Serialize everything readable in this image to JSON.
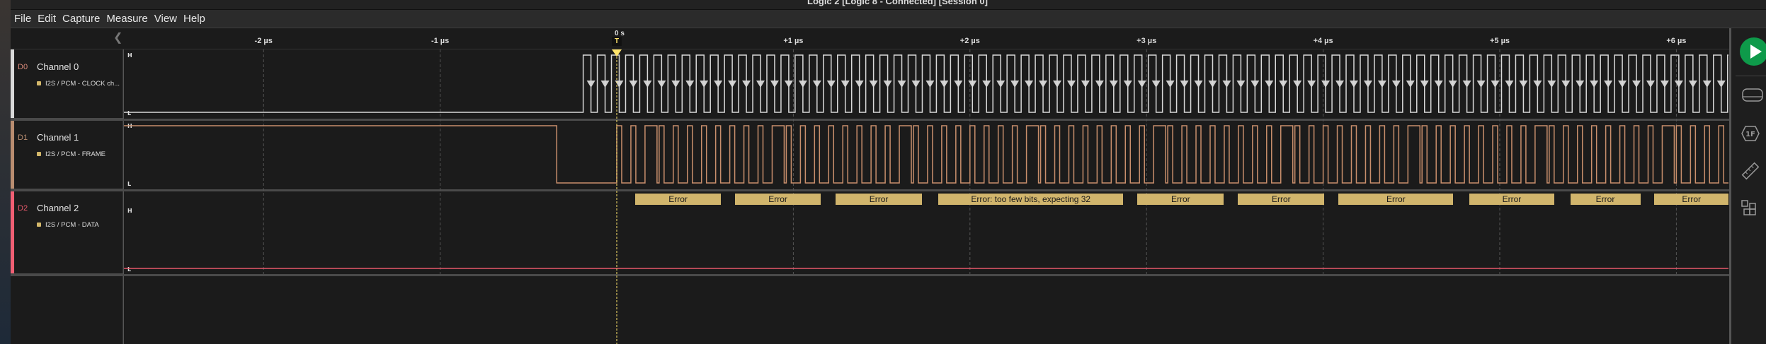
{
  "window": {
    "title": "Logic 2 [Logic 8 - Connected] [Session 0]"
  },
  "menu": [
    "File",
    "Edit",
    "Capture",
    "Measure",
    "View",
    "Help"
  ],
  "ruler": {
    "ticks": [
      {
        "t": -2,
        "label": "-2 µs"
      },
      {
        "t": -1,
        "label": "-1 µs"
      },
      {
        "t": 1,
        "label": "+1 µs"
      },
      {
        "t": 2,
        "label": "+2 µs"
      },
      {
        "t": 3,
        "label": "+3 µs"
      },
      {
        "t": 4,
        "label": "+4 µs"
      },
      {
        "t": 5,
        "label": "+5 µs"
      },
      {
        "t": 6,
        "label": "+6 µs"
      }
    ],
    "zero_label": "0 s",
    "trigger_label": "T",
    "collapse_icon": "chevron-left-icon"
  },
  "channels": [
    {
      "id": "D0",
      "name": "Channel 0",
      "analyzer": "I2S / PCM - CLOCK ch...",
      "color": "#d9d9d9",
      "high": "H",
      "low": "L"
    },
    {
      "id": "D1",
      "name": "Channel 1",
      "analyzer": "I2S / PCM - FRAME",
      "color": "#c98f6c",
      "high": "H",
      "low": "L"
    },
    {
      "id": "D2",
      "name": "Channel 2",
      "analyzer": "I2S / PCM - DATA",
      "color": "#e8596b",
      "high": "H",
      "low": "L"
    }
  ],
  "signals": {
    "time_unit": "µs",
    "view_range_us": [
      -2.9,
      6.3
    ],
    "trigger_us": 0,
    "clock": {
      "start_us": -0.19,
      "period_us": 0.08,
      "duty": 0.55
    },
    "frame": {
      "fall_us": -0.34,
      "rise_us": 0,
      "pulse_duty": 0.35
    },
    "data_level": "low"
  },
  "annotations": [
    {
      "label": "Error",
      "start": 0.104,
      "end": 0.59
    },
    {
      "label": "Error",
      "start": 0.67,
      "end": 1.155
    },
    {
      "label": "Error",
      "start": 1.239,
      "end": 1.729
    },
    {
      "label": "Error: too few bits, expecting 32",
      "start": 1.821,
      "end": 2.868
    },
    {
      "label": "Error",
      "start": 2.948,
      "end": 3.438
    },
    {
      "label": "Error",
      "start": 3.518,
      "end": 4.007
    },
    {
      "label": "Error",
      "start": 4.087,
      "end": 4.737
    },
    {
      "label": "Error",
      "start": 4.829,
      "end": 5.307
    },
    {
      "label": "Error",
      "start": 5.399,
      "end": 5.796
    },
    {
      "label": "Error",
      "start": 5.876,
      "end": 6.3
    }
  ],
  "sidebar": [
    "play-icon",
    "device-icon",
    "analyzers-icon",
    "measure-ruler-icon",
    "extensions-icon"
  ],
  "colors": {
    "accent": "#0e9a4a",
    "trigger": "#ffe46b",
    "annotation": "#d1b56c"
  }
}
